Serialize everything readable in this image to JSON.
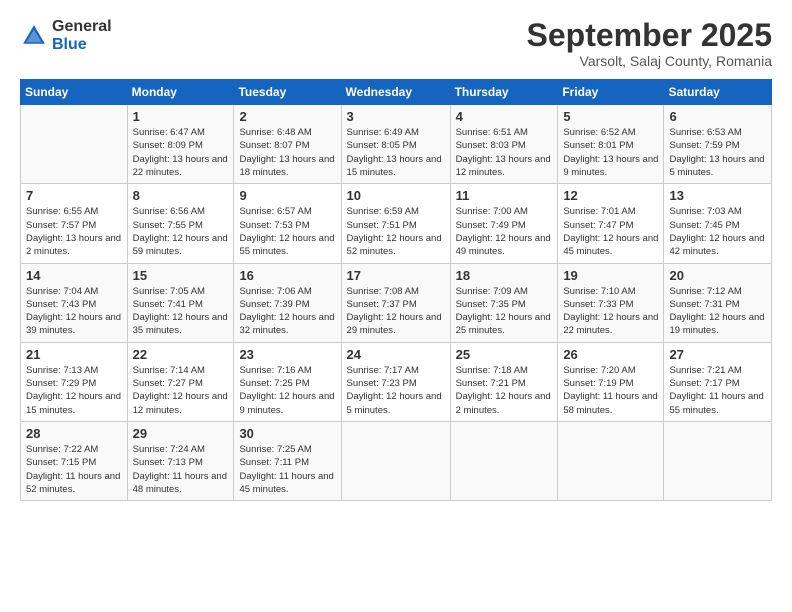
{
  "header": {
    "logo_general": "General",
    "logo_blue": "Blue",
    "month_title": "September 2025",
    "subtitle": "Varsolt, Salaj County, Romania"
  },
  "calendar": {
    "days_of_week": [
      "Sunday",
      "Monday",
      "Tuesday",
      "Wednesday",
      "Thursday",
      "Friday",
      "Saturday"
    ],
    "weeks": [
      [
        {
          "day": "",
          "sunrise": "",
          "sunset": "",
          "daylight": ""
        },
        {
          "day": "1",
          "sunrise": "Sunrise: 6:47 AM",
          "sunset": "Sunset: 8:09 PM",
          "daylight": "Daylight: 13 hours and 22 minutes."
        },
        {
          "day": "2",
          "sunrise": "Sunrise: 6:48 AM",
          "sunset": "Sunset: 8:07 PM",
          "daylight": "Daylight: 13 hours and 18 minutes."
        },
        {
          "day": "3",
          "sunrise": "Sunrise: 6:49 AM",
          "sunset": "Sunset: 8:05 PM",
          "daylight": "Daylight: 13 hours and 15 minutes."
        },
        {
          "day": "4",
          "sunrise": "Sunrise: 6:51 AM",
          "sunset": "Sunset: 8:03 PM",
          "daylight": "Daylight: 13 hours and 12 minutes."
        },
        {
          "day": "5",
          "sunrise": "Sunrise: 6:52 AM",
          "sunset": "Sunset: 8:01 PM",
          "daylight": "Daylight: 13 hours and 9 minutes."
        },
        {
          "day": "6",
          "sunrise": "Sunrise: 6:53 AM",
          "sunset": "Sunset: 7:59 PM",
          "daylight": "Daylight: 13 hours and 5 minutes."
        }
      ],
      [
        {
          "day": "7",
          "sunrise": "Sunrise: 6:55 AM",
          "sunset": "Sunset: 7:57 PM",
          "daylight": "Daylight: 13 hours and 2 minutes."
        },
        {
          "day": "8",
          "sunrise": "Sunrise: 6:56 AM",
          "sunset": "Sunset: 7:55 PM",
          "daylight": "Daylight: 12 hours and 59 minutes."
        },
        {
          "day": "9",
          "sunrise": "Sunrise: 6:57 AM",
          "sunset": "Sunset: 7:53 PM",
          "daylight": "Daylight: 12 hours and 55 minutes."
        },
        {
          "day": "10",
          "sunrise": "Sunrise: 6:59 AM",
          "sunset": "Sunset: 7:51 PM",
          "daylight": "Daylight: 12 hours and 52 minutes."
        },
        {
          "day": "11",
          "sunrise": "Sunrise: 7:00 AM",
          "sunset": "Sunset: 7:49 PM",
          "daylight": "Daylight: 12 hours and 49 minutes."
        },
        {
          "day": "12",
          "sunrise": "Sunrise: 7:01 AM",
          "sunset": "Sunset: 7:47 PM",
          "daylight": "Daylight: 12 hours and 45 minutes."
        },
        {
          "day": "13",
          "sunrise": "Sunrise: 7:03 AM",
          "sunset": "Sunset: 7:45 PM",
          "daylight": "Daylight: 12 hours and 42 minutes."
        }
      ],
      [
        {
          "day": "14",
          "sunrise": "Sunrise: 7:04 AM",
          "sunset": "Sunset: 7:43 PM",
          "daylight": "Daylight: 12 hours and 39 minutes."
        },
        {
          "day": "15",
          "sunrise": "Sunrise: 7:05 AM",
          "sunset": "Sunset: 7:41 PM",
          "daylight": "Daylight: 12 hours and 35 minutes."
        },
        {
          "day": "16",
          "sunrise": "Sunrise: 7:06 AM",
          "sunset": "Sunset: 7:39 PM",
          "daylight": "Daylight: 12 hours and 32 minutes."
        },
        {
          "day": "17",
          "sunrise": "Sunrise: 7:08 AM",
          "sunset": "Sunset: 7:37 PM",
          "daylight": "Daylight: 12 hours and 29 minutes."
        },
        {
          "day": "18",
          "sunrise": "Sunrise: 7:09 AM",
          "sunset": "Sunset: 7:35 PM",
          "daylight": "Daylight: 12 hours and 25 minutes."
        },
        {
          "day": "19",
          "sunrise": "Sunrise: 7:10 AM",
          "sunset": "Sunset: 7:33 PM",
          "daylight": "Daylight: 12 hours and 22 minutes."
        },
        {
          "day": "20",
          "sunrise": "Sunrise: 7:12 AM",
          "sunset": "Sunset: 7:31 PM",
          "daylight": "Daylight: 12 hours and 19 minutes."
        }
      ],
      [
        {
          "day": "21",
          "sunrise": "Sunrise: 7:13 AM",
          "sunset": "Sunset: 7:29 PM",
          "daylight": "Daylight: 12 hours and 15 minutes."
        },
        {
          "day": "22",
          "sunrise": "Sunrise: 7:14 AM",
          "sunset": "Sunset: 7:27 PM",
          "daylight": "Daylight: 12 hours and 12 minutes."
        },
        {
          "day": "23",
          "sunrise": "Sunrise: 7:16 AM",
          "sunset": "Sunset: 7:25 PM",
          "daylight": "Daylight: 12 hours and 9 minutes."
        },
        {
          "day": "24",
          "sunrise": "Sunrise: 7:17 AM",
          "sunset": "Sunset: 7:23 PM",
          "daylight": "Daylight: 12 hours and 5 minutes."
        },
        {
          "day": "25",
          "sunrise": "Sunrise: 7:18 AM",
          "sunset": "Sunset: 7:21 PM",
          "daylight": "Daylight: 12 hours and 2 minutes."
        },
        {
          "day": "26",
          "sunrise": "Sunrise: 7:20 AM",
          "sunset": "Sunset: 7:19 PM",
          "daylight": "Daylight: 11 hours and 58 minutes."
        },
        {
          "day": "27",
          "sunrise": "Sunrise: 7:21 AM",
          "sunset": "Sunset: 7:17 PM",
          "daylight": "Daylight: 11 hours and 55 minutes."
        }
      ],
      [
        {
          "day": "28",
          "sunrise": "Sunrise: 7:22 AM",
          "sunset": "Sunset: 7:15 PM",
          "daylight": "Daylight: 11 hours and 52 minutes."
        },
        {
          "day": "29",
          "sunrise": "Sunrise: 7:24 AM",
          "sunset": "Sunset: 7:13 PM",
          "daylight": "Daylight: 11 hours and 48 minutes."
        },
        {
          "day": "30",
          "sunrise": "Sunrise: 7:25 AM",
          "sunset": "Sunset: 7:11 PM",
          "daylight": "Daylight: 11 hours and 45 minutes."
        },
        {
          "day": "",
          "sunrise": "",
          "sunset": "",
          "daylight": ""
        },
        {
          "day": "",
          "sunrise": "",
          "sunset": "",
          "daylight": ""
        },
        {
          "day": "",
          "sunrise": "",
          "sunset": "",
          "daylight": ""
        },
        {
          "day": "",
          "sunrise": "",
          "sunset": "",
          "daylight": ""
        }
      ]
    ]
  }
}
